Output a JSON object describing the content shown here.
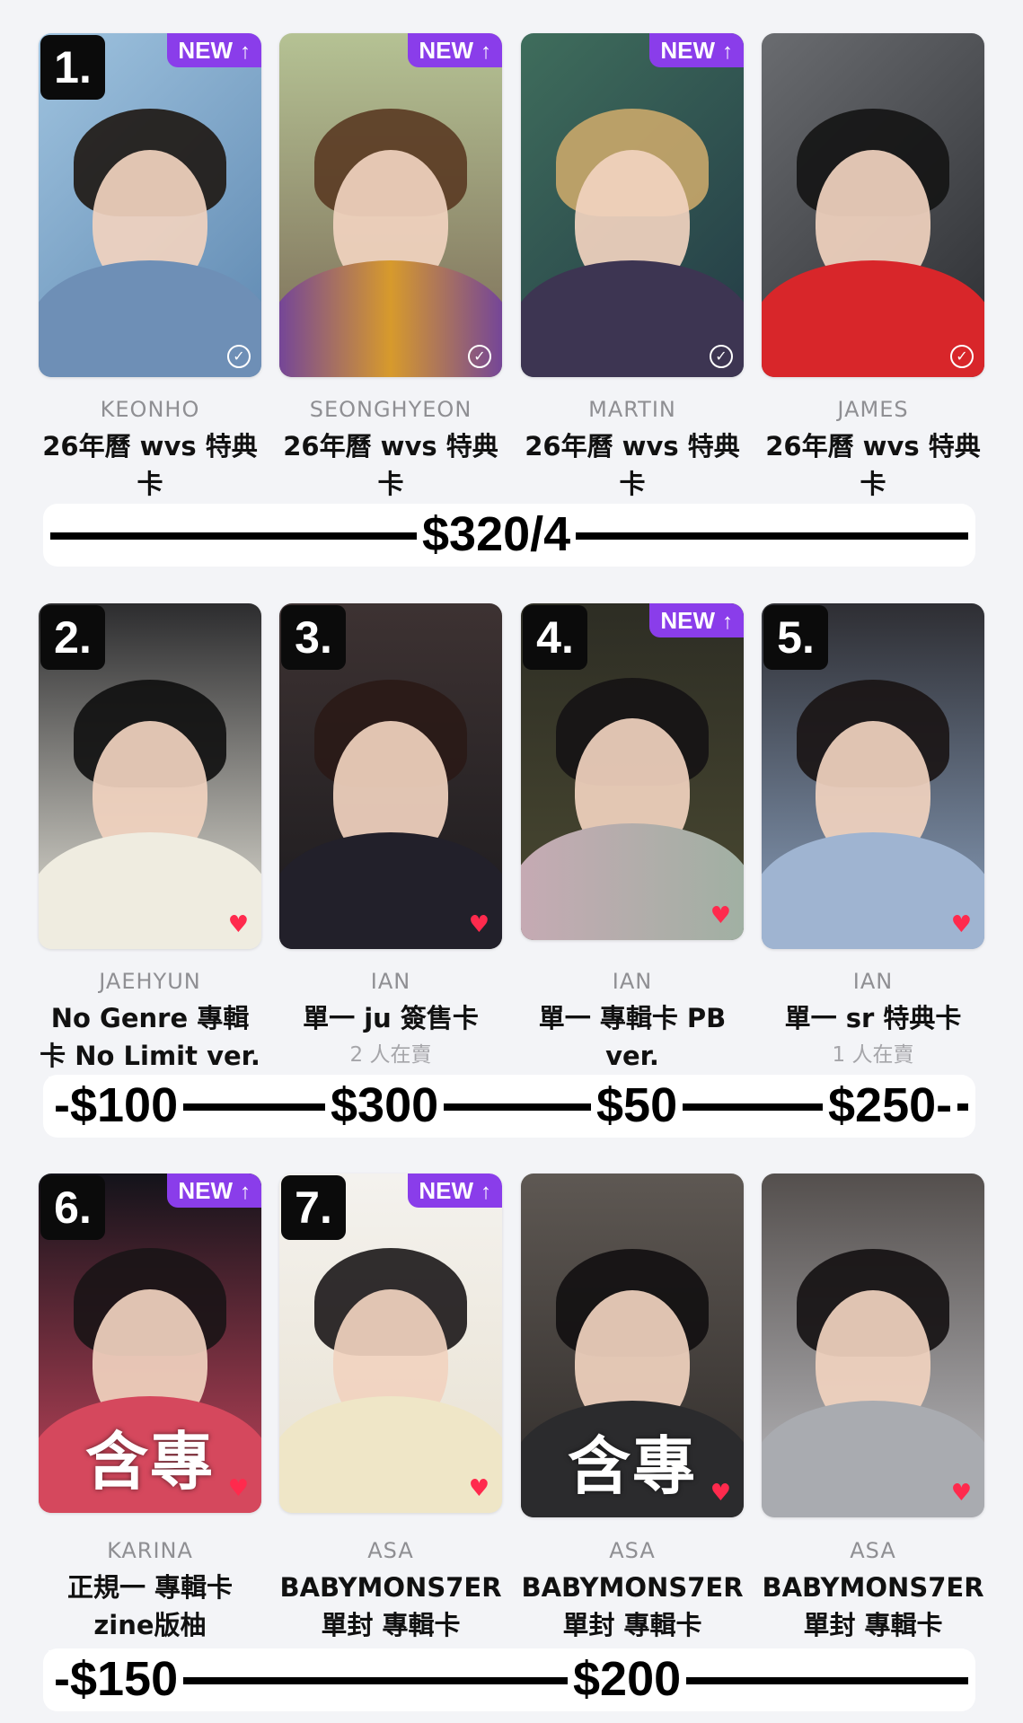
{
  "cards": [
    {
      "rank": "1.",
      "new": "NEW",
      "member": "KEONHO",
      "title": "26年曆 wvs 特典卡",
      "sellers": "",
      "mark": "check",
      "overlay": ""
    },
    {
      "rank": "",
      "new": "NEW",
      "member": "SEONGHYEON",
      "title": "26年曆 wvs 特典卡",
      "sellers": "",
      "mark": "check",
      "overlay": ""
    },
    {
      "rank": "",
      "new": "NEW",
      "member": "MARTIN",
      "title": "26年曆 wvs 特典卡",
      "sellers": "",
      "mark": "check",
      "overlay": ""
    },
    {
      "rank": "",
      "new": "",
      "member": "JAMES",
      "title": "26年曆 wvs 特典卡",
      "sellers": "",
      "mark": "check",
      "overlay": ""
    },
    {
      "rank": "2.",
      "new": "",
      "member": "JAEHYUN",
      "title": "No Genre 專輯卡 No Limit ver.",
      "sellers": "",
      "mark": "heart",
      "overlay": ""
    },
    {
      "rank": "3.",
      "new": "",
      "member": "IAN",
      "title": "單一 ju 簽售卡",
      "sellers": "2 人在賣",
      "mark": "heart",
      "overlay": ""
    },
    {
      "rank": "4.",
      "new": "NEW",
      "member": "IAN",
      "title": "單一 專輯卡 PB ver.",
      "sellers": "",
      "mark": "heart",
      "overlay": ""
    },
    {
      "rank": "5.",
      "new": "",
      "member": "IAN",
      "title": "單一 sr 特典卡",
      "sellers": "1 人在賣",
      "mark": "heart",
      "overlay": ""
    },
    {
      "rank": "6.",
      "new": "NEW",
      "member": "KARINA",
      "title": "正規一 專輯卡 zine版柚",
      "sellers": "",
      "mark": "heart",
      "overlay": "含專"
    },
    {
      "rank": "7.",
      "new": "NEW",
      "member": "ASA",
      "title": "BABYMONS7ER 單封 專輯卡",
      "sellers": "",
      "mark": "heart",
      "overlay": ""
    },
    {
      "rank": "",
      "new": "",
      "member": "ASA",
      "title": "BABYMONS7ER 單封 專輯卡",
      "sellers": "",
      "mark": "heart",
      "overlay": "含專"
    },
    {
      "rank": "",
      "new": "",
      "member": "ASA",
      "title": "BABYMONS7ER 單封 專輯卡",
      "sellers": "",
      "mark": "heart",
      "overlay": ""
    }
  ],
  "prices": {
    "row1": [
      "$320/4"
    ],
    "row2": [
      "-$100",
      "$300",
      "$50",
      "$250-"
    ],
    "row3": [
      "-$150",
      "$200"
    ]
  },
  "colors": {
    "new_badge": "#8a3dea",
    "heart": "#ff2a4d",
    "background": "#f3f4f7"
  },
  "icons": {
    "new_arrow": "arrow-up-icon",
    "heart": "heart-icon",
    "check": "check-circle-icon"
  }
}
